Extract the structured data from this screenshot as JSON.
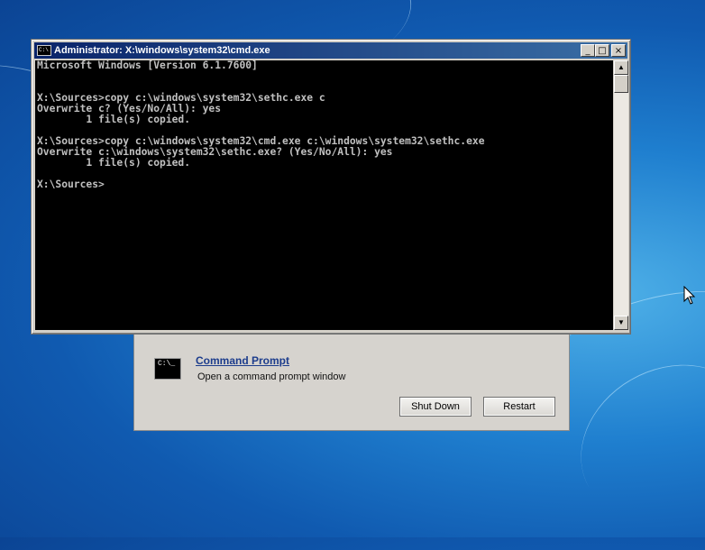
{
  "cmd_window": {
    "title": "Administrator: X:\\windows\\system32\\cmd.exe",
    "icon_label": "C:\\",
    "controls": {
      "minimize": "_",
      "maximize": "□",
      "close": "×"
    },
    "console_lines": [
      "Microsoft Windows [Version 6.1.7600]",
      "",
      "",
      "X:\\Sources>copy c:\\windows\\system32\\sethc.exe c",
      "Overwrite c? (Yes/No/All): yes",
      "        1 file(s) copied.",
      "",
      "X:\\Sources>copy c:\\windows\\system32\\cmd.exe c:\\windows\\system32\\sethc.exe",
      "Overwrite c:\\windows\\system32\\sethc.exe? (Yes/No/All): yes",
      "        1 file(s) copied.",
      "",
      "X:\\Sources>"
    ],
    "scroll_up": "▲",
    "scroll_down": "▼"
  },
  "recovery": {
    "icon_label": "C:\\_",
    "command_prompt_link": "Command Prompt",
    "command_prompt_desc": "Open a command prompt window",
    "shutdown_label": "Shut Down",
    "restart_label": "Restart"
  },
  "colors": {
    "console_bg": "#000000",
    "console_text": "#c0c0c0",
    "titlebar": "#0a246a",
    "link": "#1c3c8c"
  }
}
